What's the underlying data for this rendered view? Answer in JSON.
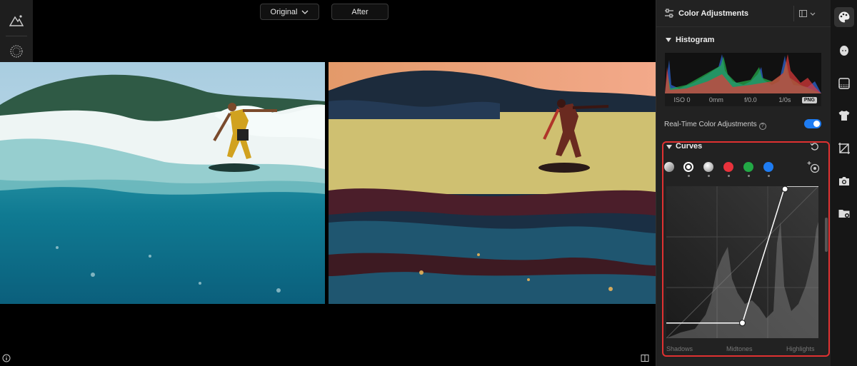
{
  "compare": {
    "original_label": "Original",
    "after_label": "After"
  },
  "panel": {
    "title": "Color Adjustments",
    "histogram": {
      "title": "Histogram",
      "exif": [
        "ISO 0",
        "0mm",
        "f/0.0",
        "1/0s"
      ],
      "format_badge": "PNG"
    },
    "realtime": {
      "label": "Real-Time Color Adjustments",
      "enabled": true
    },
    "curves": {
      "title": "Curves",
      "channels": [
        {
          "name": "luminance-pen",
          "color": "#cccccc"
        },
        {
          "name": "rgb",
          "color": "#ffffff",
          "selected": true
        },
        {
          "name": "white",
          "color": "#dddddd"
        },
        {
          "name": "red",
          "color": "#e8323c"
        },
        {
          "name": "green",
          "color": "#22a845"
        },
        {
          "name": "blue",
          "color": "#1e7cf2"
        }
      ],
      "points": [
        [
          0,
          0.1
        ],
        [
          0.5,
          0.1
        ],
        [
          0.78,
          1.0
        ],
        [
          1.0,
          1.0
        ]
      ],
      "zones": [
        "Shadows",
        "Midtones",
        "Highlights"
      ]
    }
  },
  "colors": {
    "accent": "#1e7cf2",
    "highlight_border": "#e03131"
  },
  "rail": [
    "palette-icon",
    "face-icon",
    "texture-icon",
    "shirt-icon",
    "crop-icon",
    "camera-icon",
    "folder-icon"
  ]
}
